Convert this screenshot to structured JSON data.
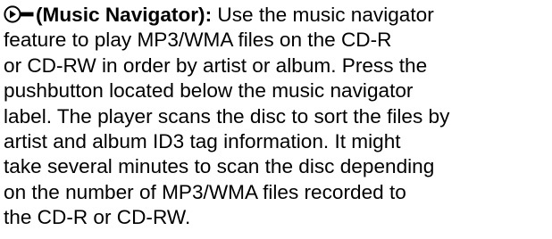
{
  "section": {
    "icon": "music-navigator-icon",
    "term": "(Music Navigator):",
    "lines": [
      " Use the music navigator",
      "feature to play MP3/WMA files on the CD-R",
      "or CD-RW in order by artist or album. Press the",
      "pushbutton located below the music navigator",
      "label. The player scans the disc to sort the files by",
      "artist and album ID3 tag information. It might",
      "take several minutes to scan the disc depending",
      "on the number of MP3/WMA files recorded to",
      "the CD-R or CD-RW."
    ]
  }
}
